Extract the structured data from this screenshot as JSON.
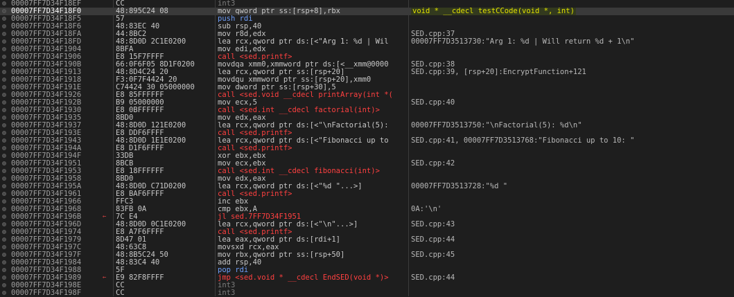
{
  "window": {
    "title": ""
  },
  "rows": [
    {
      "addr": "00007FF7D34F18EF",
      "bytes": "CC",
      "instr": "int3",
      "comment": "",
      "kind": "pad"
    },
    {
      "addr": "00007FF7D34F18F0",
      "bytes": "48:895C24 08",
      "instr": "mov qword ptr ss:[rsp+8],rbx",
      "comment": "void * __cdecl testCCode(void *, int)",
      "kind": "current"
    },
    {
      "addr": "00007FF7D34F18F5",
      "bytes": "57",
      "instr": "push rdi",
      "comment": "",
      "kind": "push"
    },
    {
      "addr": "00007FF7D34F18F6",
      "bytes": "48:83EC 40",
      "instr": "sub rsp,40",
      "comment": "",
      "kind": "normal"
    },
    {
      "addr": "00007FF7D34F18FA",
      "bytes": "44:8BC2",
      "instr": "mov r8d,edx",
      "comment": "SED.cpp:37",
      "kind": "normal"
    },
    {
      "addr": "00007FF7D34F18FD",
      "bytes": "48:8D0D 2C1E0200",
      "instr": "lea rcx,qword ptr ds:[<\"Arg 1: %d | Wil",
      "comment": "00007FF7D3513730:\"Arg 1: %d | Will return %d + 1\\n\"",
      "kind": "normal"
    },
    {
      "addr": "00007FF7D34F1904",
      "bytes": "8BFA",
      "instr": "mov edi,edx",
      "comment": "",
      "kind": "normal"
    },
    {
      "addr": "00007FF7D34F1906",
      "bytes": "E8 15F7FFFF",
      "instr": "call <sed.printf>",
      "comment": "",
      "kind": "call"
    },
    {
      "addr": "00007FF7D34F190B",
      "bytes": "66:0F6F05 8D1F0200",
      "instr": "movdqa xmm0,xmmword ptr ds:[<__xmm@0000",
      "comment": "SED.cpp:38",
      "kind": "normal"
    },
    {
      "addr": "00007FF7D34F1913",
      "bytes": "48:8D4C24 20",
      "instr": "lea rcx,qword ptr ss:[rsp+20]",
      "comment": "SED.cpp:39, [rsp+20]:EncryptFunction+121",
      "kind": "normal"
    },
    {
      "addr": "00007FF7D34F1918",
      "bytes": "F3:0F7F4424 20",
      "instr": "movdqu xmmword ptr ss:[rsp+20],xmm0",
      "comment": "",
      "kind": "normal"
    },
    {
      "addr": "00007FF7D34F191E",
      "bytes": "C74424 30 05000000",
      "instr": "mov dword ptr ss:[rsp+30],5",
      "comment": "",
      "kind": "normal"
    },
    {
      "addr": "00007FF7D34F1926",
      "bytes": "E8 85FFFFFF",
      "instr": "call <sed.void __cdecl printArray(int *(",
      "comment": "",
      "kind": "call"
    },
    {
      "addr": "00007FF7D34F192B",
      "bytes": "B9 05000000",
      "instr": "mov ecx,5",
      "comment": "SED.cpp:40",
      "kind": "normal"
    },
    {
      "addr": "00007FF7D34F1930",
      "bytes": "E8 0BFFFFFF",
      "instr": "call <sed.int __cdecl factorial(int)>",
      "comment": "",
      "kind": "call"
    },
    {
      "addr": "00007FF7D34F1935",
      "bytes": "8BD0",
      "instr": "mov edx,eax",
      "comment": "",
      "kind": "normal"
    },
    {
      "addr": "00007FF7D34F1937",
      "bytes": "48:8D0D 121E0200",
      "instr": "lea rcx,qword ptr ds:[<\"\\nFactorial(5):",
      "comment": "00007FF7D3513750:\"\\nFactorial(5): %d\\n\"",
      "kind": "normal"
    },
    {
      "addr": "00007FF7D34F193E",
      "bytes": "E8 DDF6FFFF",
      "instr": "call <sed.printf>",
      "comment": "",
      "kind": "call"
    },
    {
      "addr": "00007FF7D34F1943",
      "bytes": "48:8D0D 1E1E0200",
      "instr": "lea rcx,qword ptr ds:[<\"Fibonacci up to",
      "comment": "SED.cpp:41, 00007FF7D3513768:\"Fibonacci up to 10: \"",
      "kind": "normal"
    },
    {
      "addr": "00007FF7D34F194A",
      "bytes": "E8 D1F6FFFF",
      "instr": "call <sed.printf>",
      "comment": "",
      "kind": "call"
    },
    {
      "addr": "00007FF7D34F194F",
      "bytes": "33DB",
      "instr": "xor ebx,ebx",
      "comment": "",
      "kind": "normal"
    },
    {
      "addr": "00007FF7D34F1951",
      "bytes": "8BCB",
      "instr": "mov ecx,ebx",
      "comment": "SED.cpp:42",
      "kind": "normal"
    },
    {
      "addr": "00007FF7D34F1953",
      "bytes": "E8 18FFFFFF",
      "instr": "call <sed.int __cdecl fibonacci(int)>",
      "comment": "",
      "kind": "call"
    },
    {
      "addr": "00007FF7D34F1958",
      "bytes": "8BD0",
      "instr": "mov edx,eax",
      "comment": "",
      "kind": "normal"
    },
    {
      "addr": "00007FF7D34F195A",
      "bytes": "48:8D0D C71D0200",
      "instr": "lea rcx,qword ptr ds:[<\"%d \"...>]",
      "comment": "00007FF7D3513728:\"%d \"",
      "kind": "normal"
    },
    {
      "addr": "00007FF7D34F1961",
      "bytes": "E8 BAF6FFFF",
      "instr": "call <sed.printf>",
      "comment": "",
      "kind": "call"
    },
    {
      "addr": "00007FF7D34F1966",
      "bytes": "FFC3",
      "instr": "inc ebx",
      "comment": "",
      "kind": "normal"
    },
    {
      "addr": "00007FF7D34F1968",
      "bytes": "83FB 0A",
      "instr": "cmp ebx,A",
      "comment": "0A:'\\n'",
      "kind": "normal"
    },
    {
      "addr": "00007FF7D34F196B",
      "bytes": "7C E4",
      "instr": "jl sed.7FF7D34F1951",
      "comment": "",
      "kind": "jmp"
    },
    {
      "addr": "00007FF7D34F196D",
      "bytes": "48:8D0D 0C1E0200",
      "instr": "lea rcx,qword ptr ds:[<\"\\n\"...>]",
      "comment": "SED.cpp:43",
      "kind": "normal"
    },
    {
      "addr": "00007FF7D34F1974",
      "bytes": "E8 A7F6FFFF",
      "instr": "call <sed.printf>",
      "comment": "",
      "kind": "call"
    },
    {
      "addr": "00007FF7D34F1979",
      "bytes": "8D47 01",
      "instr": "lea eax,qword ptr ds:[rdi+1]",
      "comment": "SED.cpp:44",
      "kind": "normal"
    },
    {
      "addr": "00007FF7D34F197C",
      "bytes": "48:63C8",
      "instr": "movsxd rcx,eax",
      "comment": "",
      "kind": "normal"
    },
    {
      "addr": "00007FF7D34F197F",
      "bytes": "48:8B5C24 50",
      "instr": "mov rbx,qword ptr ss:[rsp+50]",
      "comment": "SED.cpp:45",
      "kind": "normal"
    },
    {
      "addr": "00007FF7D34F1984",
      "bytes": "48:83C4 40",
      "instr": "add rsp,40",
      "comment": "",
      "kind": "normal"
    },
    {
      "addr": "00007FF7D34F1988",
      "bytes": "5F",
      "instr": "pop rdi",
      "comment": "",
      "kind": "push"
    },
    {
      "addr": "00007FF7D34F1989",
      "bytes": "E9 82F8FFFF",
      "instr": "jmp <sed.void * __cdecl EndSED(void *)>",
      "comment": "SED.cpp:44",
      "kind": "jmp"
    },
    {
      "addr": "00007FF7D34F198E",
      "bytes": "CC",
      "instr": "int3",
      "comment": "",
      "kind": "pad"
    },
    {
      "addr": "00007FF7D34F198F",
      "bytes": "CC",
      "instr": "int3",
      "comment": "",
      "kind": "pad"
    }
  ],
  "colors": {
    "background": "#1e1e1e",
    "current_row": "#3a3a3a",
    "call": "#ff4040",
    "push": "#6f9ef8",
    "function_label": "#e0e000"
  },
  "icons": {
    "breakpoint": "breakpoint-dot-icon",
    "jump_arrow": "jump-arrow-icon"
  }
}
